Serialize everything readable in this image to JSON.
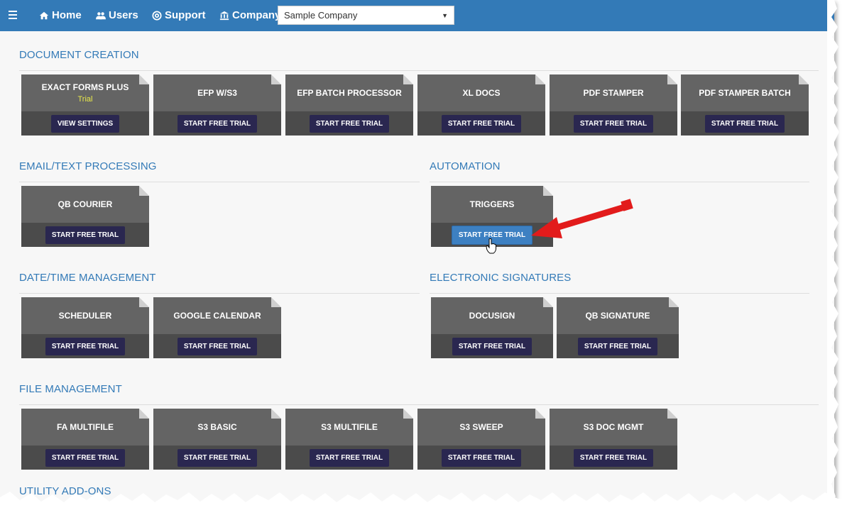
{
  "navbar": {
    "items": [
      {
        "label": "Home",
        "icon": "home-icon"
      },
      {
        "label": "Users",
        "icon": "users-icon"
      },
      {
        "label": "Support",
        "icon": "support-icon"
      },
      {
        "label": "Company",
        "icon": "bank-icon"
      }
    ],
    "company_select": {
      "value": "Sample Company"
    }
  },
  "colors": {
    "accent": "#337ab7",
    "tile": "#646464",
    "button": "#2a2750",
    "active_button": "#3d80c2"
  },
  "sections": {
    "document_creation": {
      "title": "DOCUMENT CREATION",
      "tiles": [
        {
          "name": "EXACT FORMS PLUS",
          "sub": "Trial",
          "button": "VIEW SETTINGS"
        },
        {
          "name": "EFP W/S3",
          "button": "START FREE TRIAL"
        },
        {
          "name": "EFP BATCH PROCESSOR",
          "button": "START FREE TRIAL"
        },
        {
          "name": "XL DOCS",
          "button": "START FREE TRIAL"
        },
        {
          "name": "PDF STAMPER",
          "button": "START FREE TRIAL"
        },
        {
          "name": "PDF STAMPER BATCH",
          "button": "START FREE TRIAL"
        }
      ]
    },
    "email_text": {
      "title": "EMAIL/TEXT PROCESSING",
      "tiles": [
        {
          "name": "QB COURIER",
          "button": "START FREE TRIAL"
        }
      ]
    },
    "automation": {
      "title": "AUTOMATION",
      "tiles": [
        {
          "name": "TRIGGERS",
          "button": "START FREE TRIAL"
        }
      ]
    },
    "date_time": {
      "title": "DATE/TIME MANAGEMENT",
      "tiles": [
        {
          "name": "SCHEDULER",
          "button": "START FREE TRIAL"
        },
        {
          "name": "GOOGLE CALENDAR",
          "button": "START FREE TRIAL"
        }
      ]
    },
    "esignatures": {
      "title": "ELECTRONIC SIGNATURES",
      "tiles": [
        {
          "name": "DOCUSIGN",
          "button": "START FREE TRIAL"
        },
        {
          "name": "QB SIGNATURE",
          "button": "START FREE TRIAL"
        }
      ]
    },
    "file_management": {
      "title": "FILE MANAGEMENT",
      "tiles": [
        {
          "name": "FA MULTIFILE",
          "button": "START FREE TRIAL"
        },
        {
          "name": "S3 BASIC",
          "button": "START FREE TRIAL"
        },
        {
          "name": "S3 MULTIFILE",
          "button": "START FREE TRIAL"
        },
        {
          "name": "S3 SWEEP",
          "button": "START FREE TRIAL"
        },
        {
          "name": "S3 DOC MGMT",
          "button": "START FREE TRIAL"
        }
      ]
    },
    "utility": {
      "title": "UTILITY ADD-ONS"
    }
  }
}
